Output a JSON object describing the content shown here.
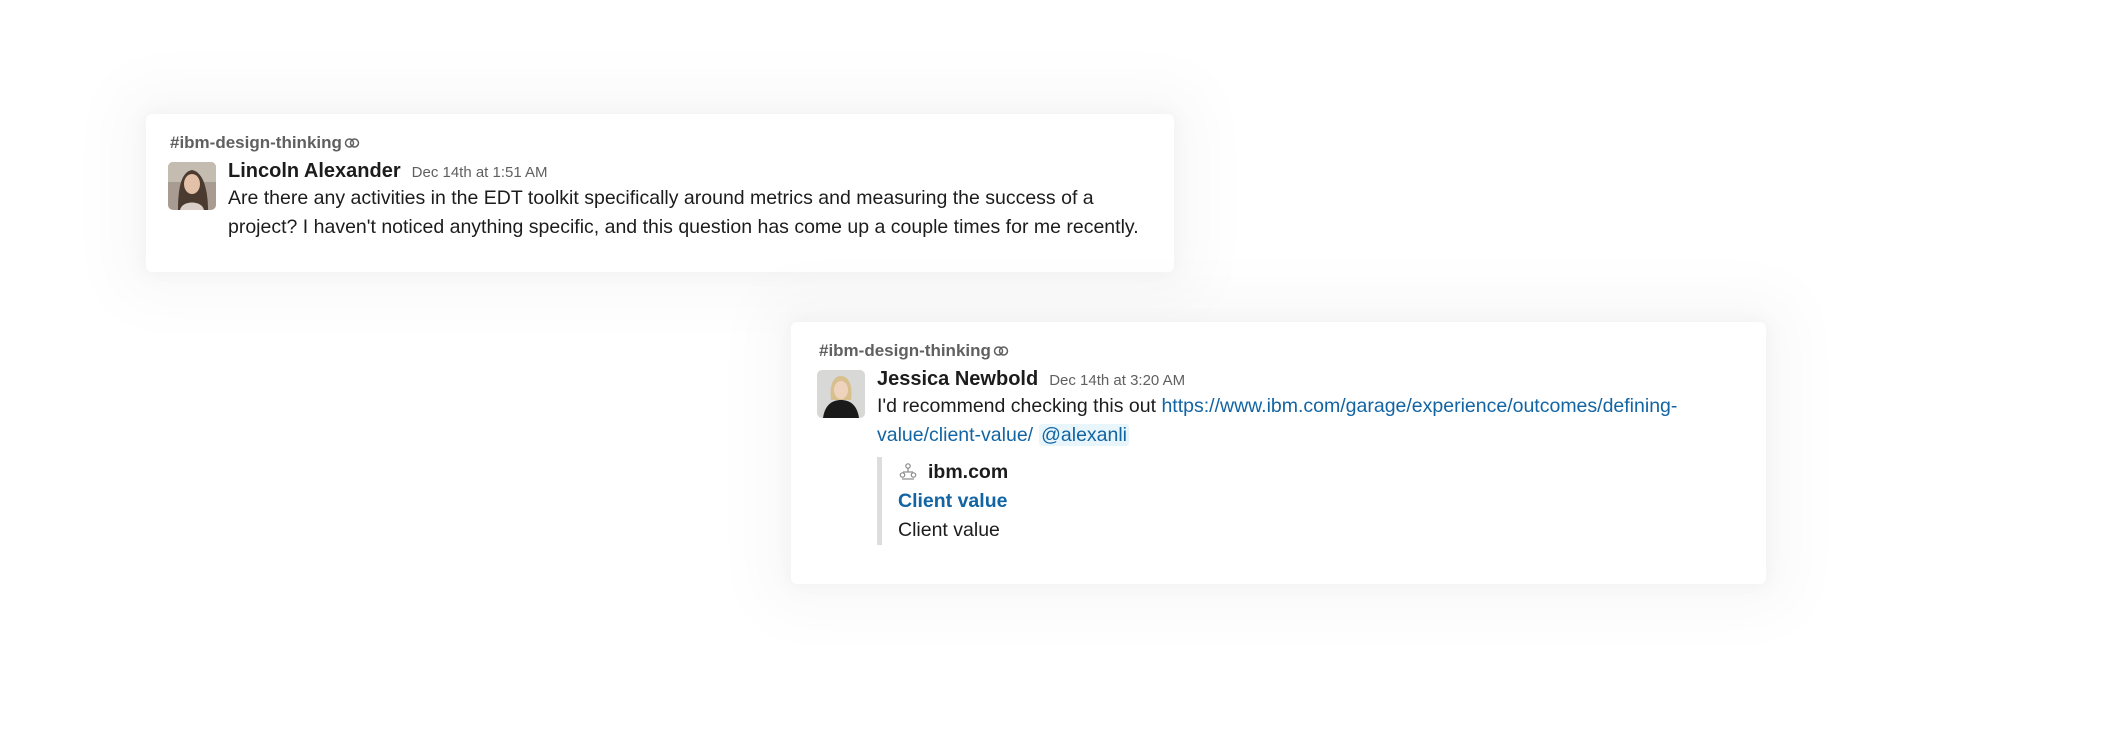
{
  "messages": [
    {
      "channel": "#ibm-design-thinking",
      "author": "Lincoln Alexander",
      "timestamp": "Dec 14th at 1:51 AM",
      "text_line1": "Are there any activities in the EDT toolkit specifically around metrics and measuring the success of a",
      "text_line2": "project?  I haven't noticed anything specific, and this question has come up a couple times for me recently."
    },
    {
      "channel": "#ibm-design-thinking",
      "author": "Jessica Newbold",
      "timestamp": "Dec 14th at 3:20 AM",
      "text_prefix": "I'd recommend checking this out ",
      "link_line1": "https://www.ibm.com/garage/experience/outcomes/defining-",
      "link_line2": "value/client-value/",
      "mention": "@alexanli",
      "unfurl": {
        "site_icon": "ibm-site-icon",
        "site_name": "ibm.com",
        "title": "Client value",
        "description": "Client value"
      }
    }
  ],
  "icons": {
    "shared_channel": "shared-channel-icon"
  },
  "colors": {
    "link": "#1264a3",
    "mention_bg": "#e8f5fa",
    "muted": "#616061",
    "text": "#1d1c1d"
  }
}
